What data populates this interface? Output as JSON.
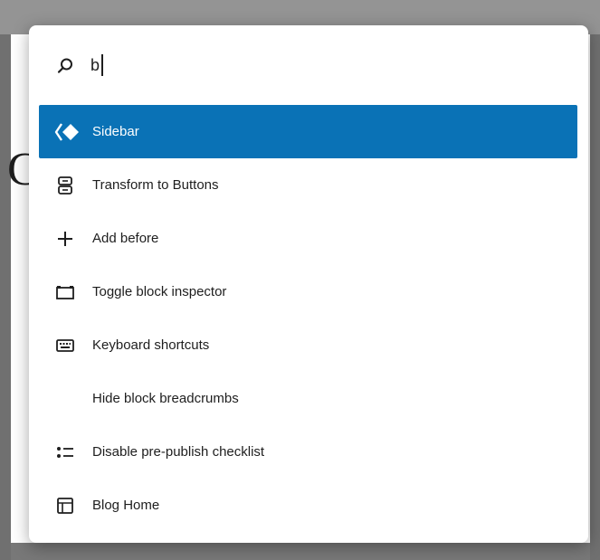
{
  "background": {
    "partial_letter": "C"
  },
  "command_palette": {
    "search": {
      "value": "b",
      "placeholder": ""
    },
    "items": [
      {
        "label": "Sidebar",
        "icon": "sidebar-diamond-icon",
        "selected": true
      },
      {
        "label": "Transform to Buttons",
        "icon": "buttons-icon",
        "selected": false
      },
      {
        "label": "Add before",
        "icon": "plus-icon",
        "selected": false
      },
      {
        "label": "Toggle block inspector",
        "icon": "block-inspector-icon",
        "selected": false
      },
      {
        "label": "Keyboard shortcuts",
        "icon": "keyboard-icon",
        "selected": false
      },
      {
        "label": "Hide block breadcrumbs",
        "icon": "",
        "selected": false
      },
      {
        "label": "Disable pre-publish checklist",
        "icon": "checklist-icon",
        "selected": false
      },
      {
        "label": "Blog Home",
        "icon": "layout-icon",
        "selected": false
      }
    ]
  },
  "colors": {
    "selected": "#0a72b6",
    "text": "#1e1e1e"
  }
}
